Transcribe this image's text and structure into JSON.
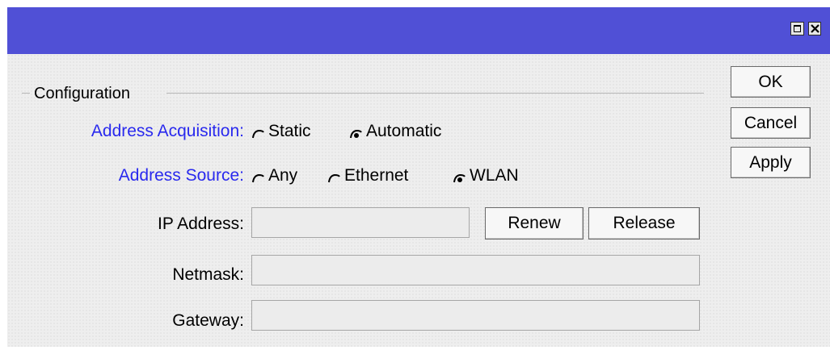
{
  "window": {
    "controls": [
      "maximize",
      "close"
    ]
  },
  "configuration": {
    "legend": "Configuration",
    "address_acquisition": {
      "label": "Address Acquisition:",
      "options": [
        "Static",
        "Automatic"
      ],
      "selected": "Automatic"
    },
    "address_source": {
      "label": "Address Source:",
      "options": [
        "Any",
        "Ethernet",
        "WLAN"
      ],
      "selected": "WLAN"
    },
    "ip_address": {
      "label": "IP Address:",
      "value": ""
    },
    "netmask": {
      "label": "Netmask:",
      "value": ""
    },
    "gateway": {
      "label": "Gateway:",
      "value": ""
    },
    "renew_label": "Renew",
    "release_label": "Release"
  },
  "buttons": {
    "ok": "OK",
    "cancel": "Cancel",
    "apply": "Apply"
  },
  "colors": {
    "titlebar": "#5050d6",
    "label_blue": "#2929ee",
    "dialog_bg": "#eeeeee"
  }
}
